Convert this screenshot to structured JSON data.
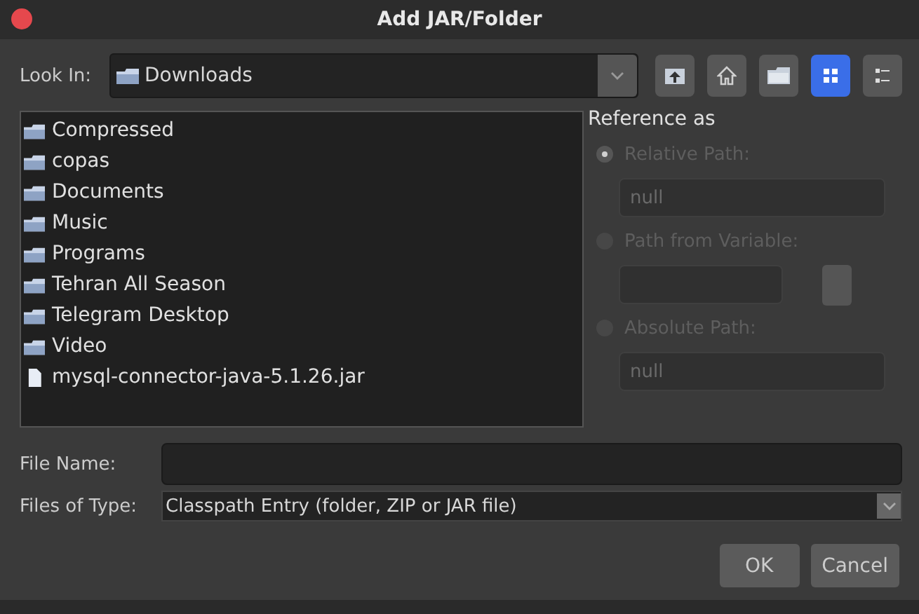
{
  "window": {
    "title": "Add JAR/Folder"
  },
  "look_in": {
    "label": "Look In:",
    "value": "Downloads"
  },
  "toolbar": [
    {
      "kind": "up",
      "selected": false
    },
    {
      "kind": "home",
      "selected": false
    },
    {
      "kind": "newfolder",
      "selected": false
    },
    {
      "kind": "list",
      "selected": true
    },
    {
      "kind": "details",
      "selected": false
    }
  ],
  "files": [
    {
      "name": "Compressed",
      "kind": "folder"
    },
    {
      "name": "copas",
      "kind": "folder"
    },
    {
      "name": "Documents",
      "kind": "folder"
    },
    {
      "name": "Music",
      "kind": "folder"
    },
    {
      "name": "Programs",
      "kind": "folder"
    },
    {
      "name": "Tehran All Season",
      "kind": "folder"
    },
    {
      "name": "Telegram Desktop",
      "kind": "folder"
    },
    {
      "name": "Video",
      "kind": "folder"
    },
    {
      "name": "mysql-connector-java-5.1.26.jar",
      "kind": "file"
    }
  ],
  "reference": {
    "title": "Reference as",
    "options": [
      {
        "label": "Relative Path:",
        "selected": true,
        "disabled": true,
        "value": "null",
        "kind": "field"
      },
      {
        "label": "Path from Variable:",
        "selected": false,
        "disabled": true,
        "kind": "variable"
      },
      {
        "label": "Absolute Path:",
        "selected": false,
        "disabled": true,
        "value": "null",
        "kind": "field"
      }
    ]
  },
  "file_name": {
    "label": "File Name:"
  },
  "files_of_type": {
    "label": "Files of Type:",
    "value": "Classpath Entry (folder, ZIP or JAR file)"
  },
  "buttons": [
    "OK",
    "Cancel"
  ]
}
